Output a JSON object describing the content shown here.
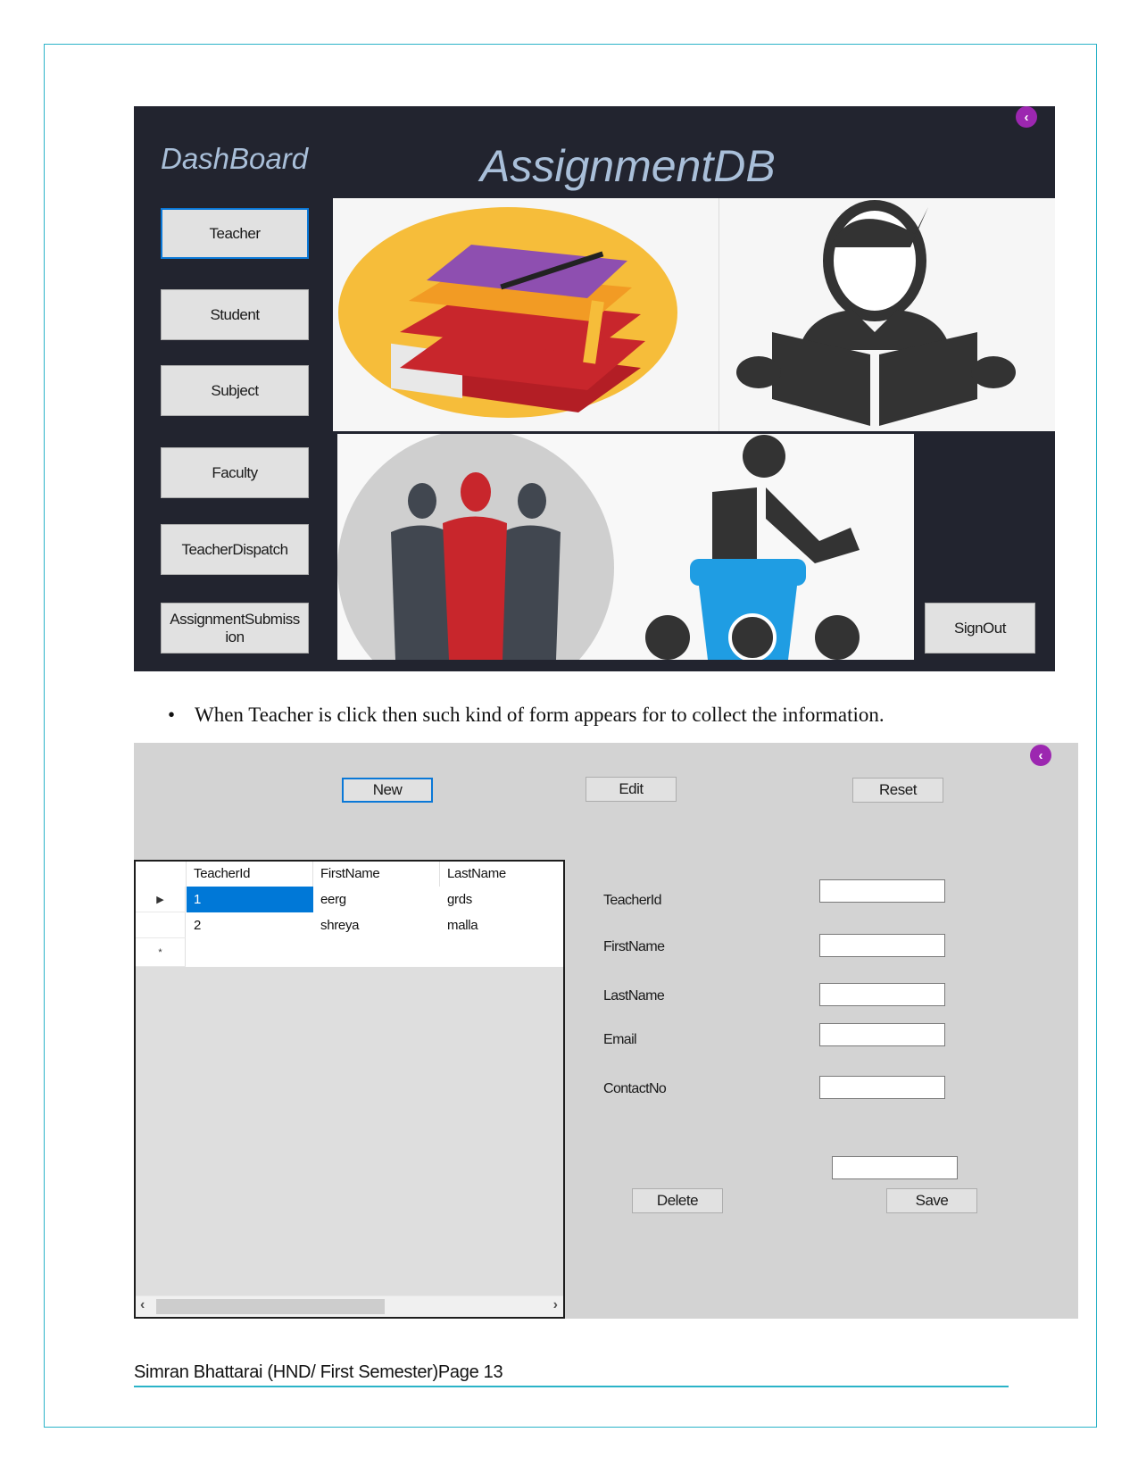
{
  "dashboard": {
    "sidebar_title": "DashBoard",
    "app_title": "AssignmentDB",
    "back_icon": "chevron-left-circle-icon",
    "nav_buttons": [
      {
        "label": "Teacher",
        "focused": true
      },
      {
        "label": "Student"
      },
      {
        "label": "Subject"
      },
      {
        "label": "Faculty"
      },
      {
        "label": "TeacherDispatch"
      },
      {
        "label": "AssignmentSubmiss ion"
      }
    ],
    "signout_label": "SignOut",
    "images": [
      "books-stack-illustration",
      "person-reading-book-illustration",
      "business-team-illustration",
      "speaker-at-podium-illustration"
    ]
  },
  "bullet": {
    "text": "When Teacher is click then such kind of form appears for to collect the information."
  },
  "teacher_form": {
    "back_icon": "chevron-left-circle-icon",
    "top_buttons": {
      "new": "New",
      "edit": "Edit",
      "reset": "Reset"
    },
    "grid": {
      "columns": [
        "TeacherId",
        "FirstName",
        "LastName"
      ],
      "rows": [
        {
          "TeacherId": "1",
          "FirstName": "eerg",
          "LastName": "grds",
          "selected": true
        },
        {
          "TeacherId": "2",
          "FirstName": "shreya",
          "LastName": "malla"
        }
      ],
      "current_row_marker": "▶",
      "new_row_marker": "*"
    },
    "fields": [
      {
        "label": "TeacherId",
        "value": ""
      },
      {
        "label": "FirstName",
        "value": ""
      },
      {
        "label": "LastName",
        "value": ""
      },
      {
        "label": "Email",
        "value": ""
      },
      {
        "label": "ContactNo",
        "value": ""
      }
    ],
    "extra_input_value": "",
    "delete_label": "Delete",
    "save_label": "Save"
  },
  "footer": {
    "text": "Simran Bhattarai (HND/ First Semester)Page 13"
  },
  "colors": {
    "accent_border": "#2bb3c8",
    "dashboard_bg": "#22242f",
    "form_bg": "#d3d3d3",
    "selection": "#0078d7",
    "back_icon": "#9c27b0"
  }
}
